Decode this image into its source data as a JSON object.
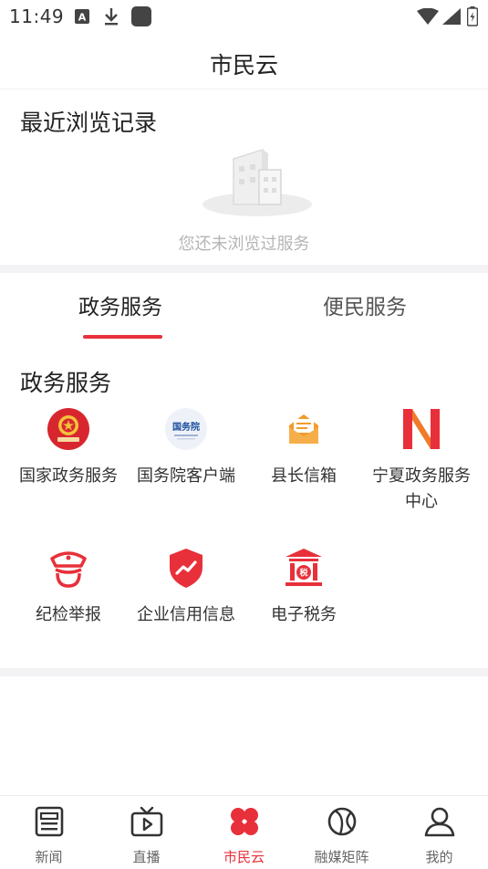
{
  "status_bar": {
    "time": "11:49"
  },
  "header": {
    "title": "市民云"
  },
  "recent": {
    "heading": "最近浏览记录",
    "empty_text": "您还未浏览过服务"
  },
  "tabs": [
    {
      "label": "政务服务",
      "active": true
    },
    {
      "label": "便民服务",
      "active": false
    }
  ],
  "services": {
    "heading": "政务服务",
    "items": [
      {
        "label": "国家政务服务",
        "icon": "national-emblem-icon",
        "color": "#d8262f"
      },
      {
        "label": "国务院客户端",
        "icon": "state-council-icon",
        "color": "#1f4fa0"
      },
      {
        "label": "县长信箱",
        "icon": "mailbox-icon",
        "color": "#f29b2c"
      },
      {
        "label": "宁夏政务服务中心",
        "icon": "ningxia-logo-icon",
        "color": "#e8303a"
      },
      {
        "label": "纪检举报",
        "icon": "inspector-cap-icon",
        "color": "#e8303a"
      },
      {
        "label": "企业信用信息",
        "icon": "credit-shield-icon",
        "color": "#e8303a"
      },
      {
        "label": "电子税务",
        "icon": "tax-bureau-icon",
        "color": "#e8303a"
      }
    ]
  },
  "bottom_nav": [
    {
      "label": "新闻",
      "icon": "newspaper-icon",
      "active": false
    },
    {
      "label": "直播",
      "icon": "tv-play-icon",
      "active": false
    },
    {
      "label": "市民云",
      "icon": "clover-icon",
      "active": true
    },
    {
      "label": "融媒矩阵",
      "icon": "media-matrix-icon",
      "active": false
    },
    {
      "label": "我的",
      "icon": "user-icon",
      "active": false
    }
  ],
  "colors": {
    "accent": "#e8303a",
    "muted_text": "#b5b5b5",
    "divider": "#f3f3f5"
  }
}
